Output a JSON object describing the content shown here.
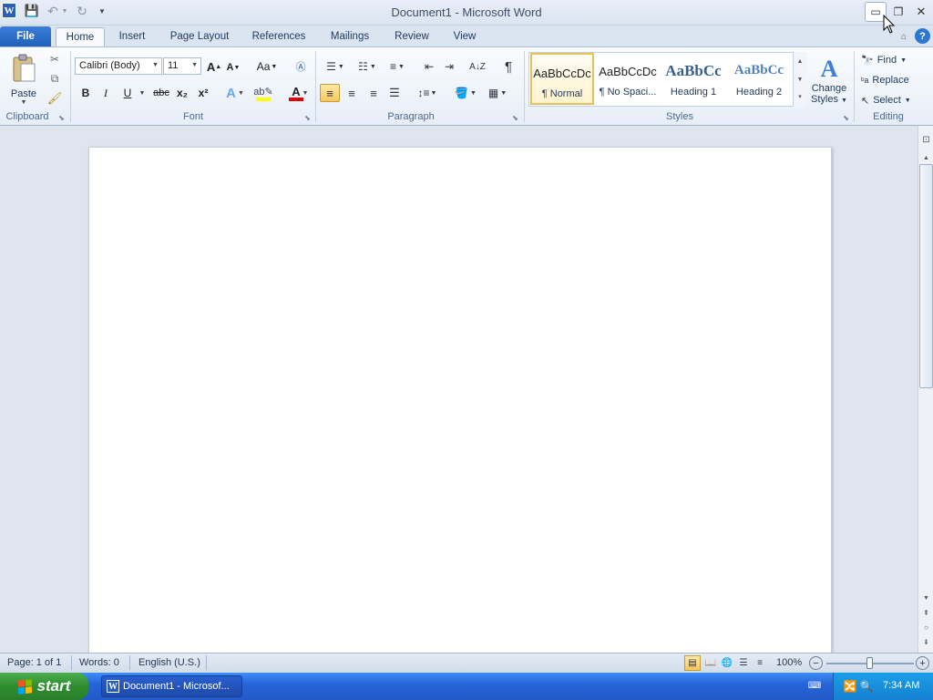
{
  "window": {
    "title": "Document1 - Microsoft Word"
  },
  "tabs": [
    {
      "label": "File"
    },
    {
      "label": "Home"
    },
    {
      "label": "Insert"
    },
    {
      "label": "Page Layout"
    },
    {
      "label": "References"
    },
    {
      "label": "Mailings"
    },
    {
      "label": "Review"
    },
    {
      "label": "View"
    }
  ],
  "ribbon": {
    "clipboard": {
      "label": "Clipboard",
      "paste": "Paste"
    },
    "font": {
      "label": "Font",
      "family": "Calibri (Body)",
      "size": "11",
      "grow": "A",
      "shrink": "A",
      "change_case": "Aa",
      "bold": "B",
      "italic": "I",
      "underline": "U",
      "strike": "abc",
      "subscript": "x₂",
      "superscript": "x²",
      "text_effects": "A",
      "font_color": "A"
    },
    "paragraph": {
      "label": "Paragraph",
      "pilcrow": "¶",
      "sort": "A↓Z"
    },
    "styles": {
      "label": "Styles",
      "items": [
        {
          "sample": "AaBbCcDc",
          "name": "¶ Normal",
          "color": "#222222"
        },
        {
          "sample": "AaBbCcDc",
          "name": "¶ No Spaci...",
          "color": "#222222"
        },
        {
          "sample": "AaBbCc",
          "name": "Heading 1",
          "color": "#365f91"
        },
        {
          "sample": "AaBbCc",
          "name": "Heading 2",
          "color": "#4f81bd"
        }
      ],
      "change_styles_line1": "Change",
      "change_styles_line2": "Styles"
    },
    "editing": {
      "label": "Editing",
      "find": "Find",
      "replace": "Replace",
      "select": "Select"
    }
  },
  "status": {
    "page": "Page: 1 of 1",
    "words": "Words: 0",
    "language": "English (U.S.)",
    "zoom": "100%"
  },
  "taskbar": {
    "start": "start",
    "task": "Document1 - Microsof...",
    "clock": "7:34 AM"
  }
}
